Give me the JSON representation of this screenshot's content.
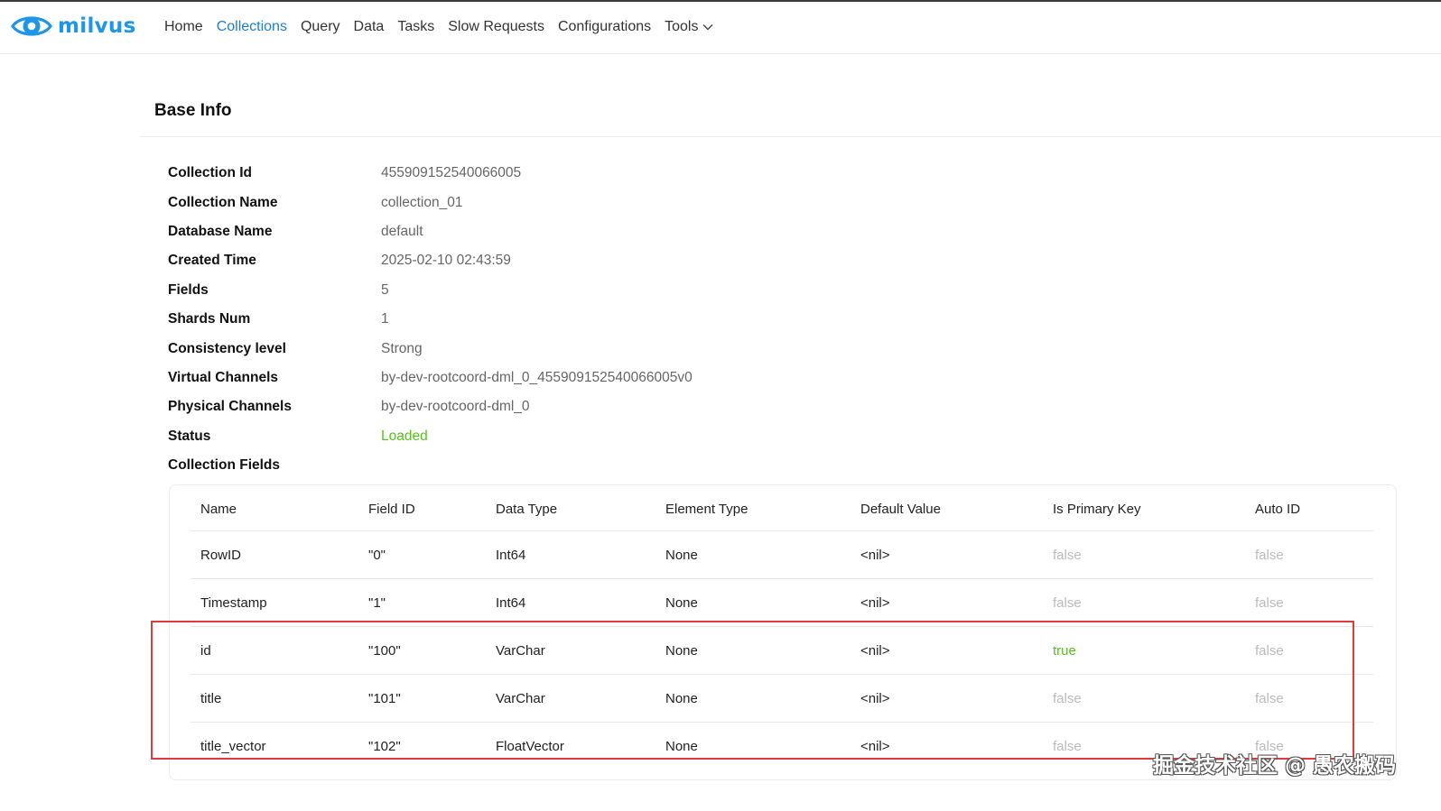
{
  "app": {
    "logo_text": "milvus",
    "accent_color": "#1e96e8"
  },
  "nav": {
    "items": [
      {
        "label": "Home"
      },
      {
        "label": "Collections",
        "active": true
      },
      {
        "label": "Query"
      },
      {
        "label": "Data"
      },
      {
        "label": "Tasks"
      },
      {
        "label": "Slow Requests"
      },
      {
        "label": "Configurations"
      },
      {
        "label": "Tools",
        "icon": "chevron-down-icon"
      }
    ]
  },
  "base_info": {
    "title": "Base Info",
    "rows": [
      {
        "label": "Collection Id",
        "value": "455909152540066005"
      },
      {
        "label": "Collection Name",
        "value": "collection_01"
      },
      {
        "label": "Database Name",
        "value": "default"
      },
      {
        "label": "Created Time",
        "value": "2025-02-10 02:43:59"
      },
      {
        "label": "Fields",
        "value": "5"
      },
      {
        "label": "Shards Num",
        "value": "1"
      },
      {
        "label": "Consistency level",
        "value": "Strong"
      },
      {
        "label": "Virtual Channels",
        "value": "by-dev-rootcoord-dml_0_455909152540066005v0"
      },
      {
        "label": "Physical Channels",
        "value": "by-dev-rootcoord-dml_0"
      },
      {
        "label": "Status",
        "value": "Loaded",
        "status_color": "#52c41a"
      },
      {
        "label": "Collection Fields",
        "value": ""
      }
    ]
  },
  "fields_table": {
    "headers": [
      "Name",
      "Field ID",
      "Data Type",
      "Element Type",
      "Default Value",
      "Is Primary Key",
      "Auto ID"
    ],
    "rows": [
      [
        "RowID",
        "\"0\"",
        "Int64",
        "None",
        "<nil>",
        "false",
        "false"
      ],
      [
        "Timestamp",
        "\"1\"",
        "Int64",
        "None",
        "<nil>",
        "false",
        "false"
      ],
      [
        "id",
        "\"100\"",
        "VarChar",
        "None",
        "<nil>",
        "true",
        "false"
      ],
      [
        "title",
        "\"101\"",
        "VarChar",
        "None",
        "<nil>",
        "false",
        "false"
      ],
      [
        "title_vector",
        "\"102\"",
        "FloatVector",
        "None",
        "<nil>",
        "false",
        "false"
      ]
    ]
  },
  "highlight_color": "#e03a3a",
  "watermark": "掘金技术社区 @ 愚农搬码"
}
